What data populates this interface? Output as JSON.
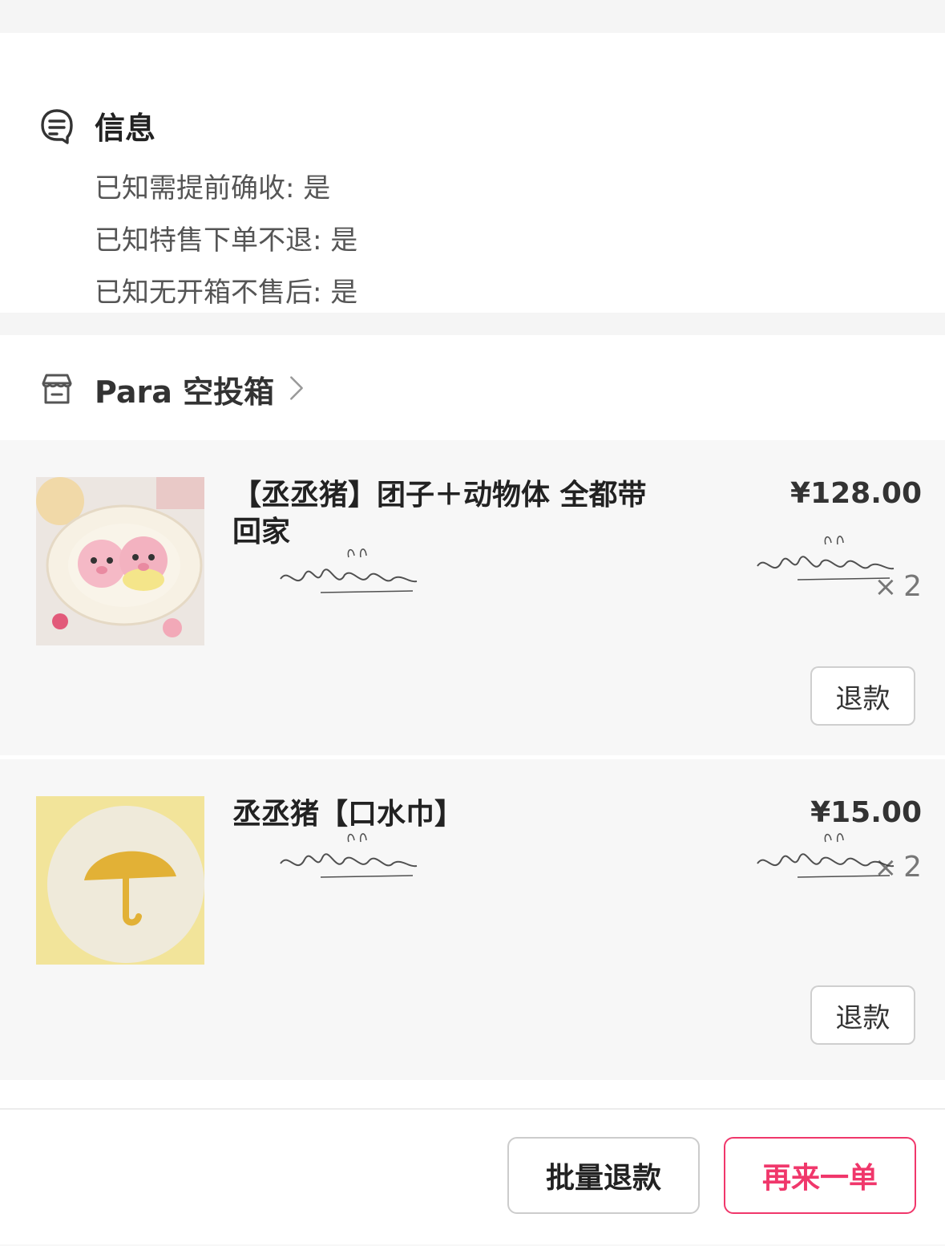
{
  "info": {
    "title": "信息",
    "lines": [
      "已知需提前确收: 是",
      "已知特售下单不退: 是",
      "已知无开箱不售后: 是"
    ]
  },
  "shop": {
    "name": "Para 空投箱"
  },
  "items": [
    {
      "title": "【丞丞猪】团子＋动物体 全都带回家",
      "price": "¥128.00",
      "qty_symbol": "×",
      "qty": "2",
      "refund_label": "退款"
    },
    {
      "title": "丞丞猪【口水巾】",
      "price": "¥15.00",
      "qty_symbol": "×",
      "qty": "2",
      "refund_label": "退款"
    }
  ],
  "footer": {
    "batch_refund": "批量退款",
    "reorder": "再来一单"
  },
  "colors": {
    "accent": "#f0376b",
    "background": "#f7f7f7"
  }
}
